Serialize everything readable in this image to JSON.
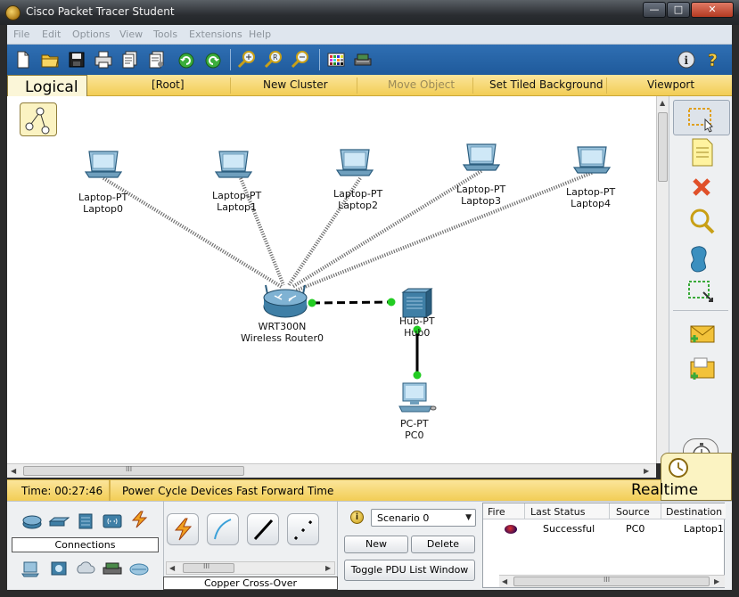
{
  "window": {
    "title": "Cisco Packet Tracer Student",
    "min_glyph": "—",
    "max_glyph": "□",
    "close_glyph": "✕"
  },
  "menu": [
    "File",
    "Edit",
    "Options",
    "View",
    "Tools",
    "Extensions",
    "Help"
  ],
  "toolbar": {
    "icons": [
      "new-file-icon",
      "open-folder-icon",
      "save-icon",
      "print-icon",
      "activity-wizard-icon",
      "pdu-icon",
      "undo-icon",
      "redo-icon",
      "zoom-in-icon",
      "zoom-reset-icon",
      "zoom-out-icon",
      "palette-icon",
      "custom-device-icon",
      "info-icon",
      "help-icon"
    ]
  },
  "workspace_bar": {
    "tab_label": "Logical",
    "root": "[Root]",
    "new_cluster": "New Cluster",
    "move_object": "Move Object",
    "set_tiled_background": "Set Tiled Background",
    "viewport": "Viewport"
  },
  "devices": [
    {
      "id": "laptop0",
      "type": "Laptop-PT",
      "name": "Laptop0"
    },
    {
      "id": "laptop1",
      "type": "Laptop-PT",
      "name": "Laptop1"
    },
    {
      "id": "laptop2",
      "type": "Laptop-PT",
      "name": "Laptop2"
    },
    {
      "id": "laptop3",
      "type": "Laptop-PT",
      "name": "Laptop3"
    },
    {
      "id": "laptop4",
      "type": "Laptop-PT",
      "name": "Laptop4"
    },
    {
      "id": "router",
      "type": "WRT300N",
      "name": "Wireless Router0"
    },
    {
      "id": "hub",
      "type": "Hub-PT",
      "name": "Hub0"
    },
    {
      "id": "pc",
      "type": "PC-PT",
      "name": "PC0"
    }
  ],
  "right_tools": [
    "select-tool-icon",
    "note-icon",
    "delete-icon",
    "inspect-icon",
    "draw-shape-icon",
    "resize-icon",
    "add-simple-pdu-icon",
    "add-complex-pdu-icon"
  ],
  "realtime_bar": {
    "time": "Time: 00:27:46",
    "power_cycle": "Power Cycle Devices",
    "fast_forward": "Fast Forward Time",
    "mode_label": "Realtime"
  },
  "bottom": {
    "category_label": "Connections",
    "connection_name": "Copper Cross-Over",
    "scenario": "Scenario 0",
    "new_label": "New",
    "delete_label": "Delete",
    "toggle_label": "Toggle PDU List Window",
    "scroll_glyph": "III",
    "pdu_headers": [
      "Fire",
      "Last Status",
      "Source",
      "Destination"
    ],
    "pdu_rows": [
      {
        "last_status": "Successful",
        "source": "PC0",
        "destination": "Laptop1"
      }
    ]
  },
  "colors": {
    "toolbar_blue": "#2f6fb3",
    "workspace_yellow": "#f2cd55",
    "link_green": "#22cc22",
    "device_blue": "#3f7fa6"
  }
}
